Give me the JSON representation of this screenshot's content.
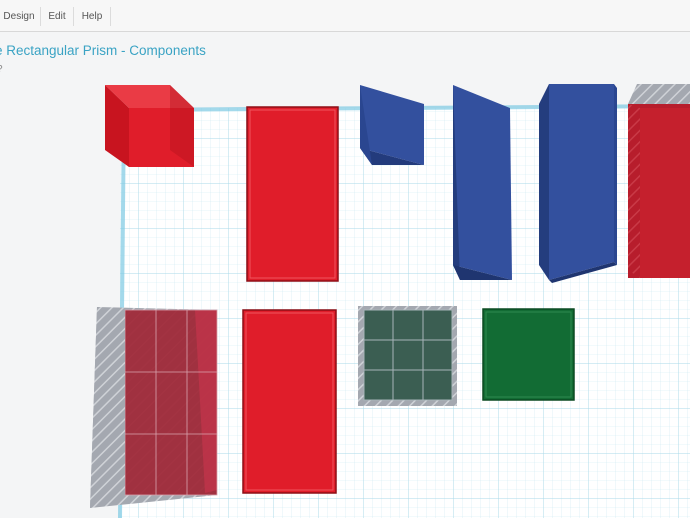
{
  "menu": {
    "items": [
      {
        "label": "Design"
      },
      {
        "label": "Edit"
      },
      {
        "label": "Help"
      }
    ]
  },
  "design": {
    "title": "le Rectangular Prism - Components",
    "subtitle": "?"
  },
  "colors": {
    "red": "#e01d2a",
    "blue": "#33509e",
    "green": "#126c34",
    "hole": "#9a9ea8",
    "grid": "#bfe6f1",
    "accent": "#3aa3c4"
  },
  "workplane": {
    "shapes": [
      {
        "name": "red-cube",
        "color": "red"
      },
      {
        "name": "red-tall-box",
        "color": "red"
      },
      {
        "name": "blue-wedge-small",
        "color": "blue"
      },
      {
        "name": "blue-wedge-tall",
        "color": "blue"
      },
      {
        "name": "blue-box-tall",
        "color": "blue"
      },
      {
        "name": "red-box-edge-with-hole-cap",
        "color": "red"
      },
      {
        "name": "red-box-with-hole-overlay",
        "color": "red"
      },
      {
        "name": "red-flat-box",
        "color": "red"
      },
      {
        "name": "green-square-with-hole-grid",
        "color": "green"
      },
      {
        "name": "green-square",
        "color": "green"
      }
    ]
  }
}
